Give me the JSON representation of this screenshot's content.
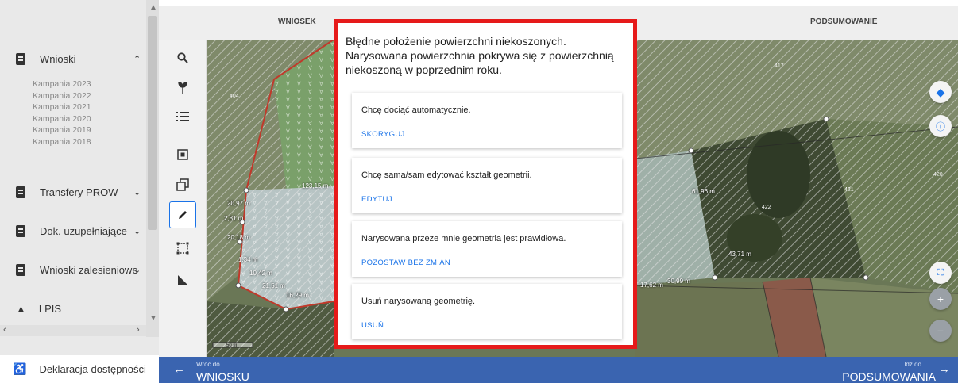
{
  "sidebar": {
    "items": [
      {
        "label": "Wnioski",
        "chevron": "^"
      },
      {
        "label": "Transfery PROW",
        "chevron": "v"
      },
      {
        "label": "Dok. uzupełniające",
        "chevron": "v"
      },
      {
        "label": "Wnioski zalesieniowe",
        "chevron": "v"
      },
      {
        "label": "LPIS",
        "chevron": ""
      }
    ],
    "campaigns": [
      "Kampania 2023",
      "Kampania 2022",
      "Kampania 2021",
      "Kampania 2020",
      "Kampania 2019",
      "Kampania 2018"
    ],
    "footer_label": "Deklaracja dostępności"
  },
  "tabs": {
    "left": "WNIOSEK",
    "right": "PODSUMOWANIE"
  },
  "map": {
    "labels": [
      "404",
      "417",
      "420",
      "421",
      "422",
      "123,15 m",
      "20,97 m",
      "2,81 m",
      "20,18 m",
      "1,34 m",
      "10,42 m",
      "21,51 m",
      "16,29 m",
      "61,96 m",
      "43,71 m",
      "30,99 m",
      "17,62 m"
    ],
    "scale_label": "50 m"
  },
  "bottom": {
    "back_small": "Wróć do",
    "back_big": "WNIOSKU",
    "next_small": "Idź do",
    "next_big": "PODSUMOWANIA"
  },
  "modal": {
    "title": "Błędne położenie powierzchni niekoszonych. Narysowana powierzchnia pokrywa się z powierzchnią niekoszoną w poprzednim roku.",
    "options": [
      {
        "text": "Chcę dociąć automatycznie.",
        "button": "SKORYGUJ"
      },
      {
        "text": "Chcę sama/sam edytować kształt geometrii.",
        "button": "EDYTUJ"
      },
      {
        "text": "Narysowana przeze mnie geometria jest prawidłowa.",
        "button": "POZOSTAW BEZ ZMIAN"
      },
      {
        "text": "Usuń narysowaną geometrię.",
        "button": "USUŃ"
      }
    ]
  },
  "colors": {
    "accent": "#1a73e8",
    "highlight_border": "#e61a1a",
    "bottombar": "#3a64b0"
  }
}
